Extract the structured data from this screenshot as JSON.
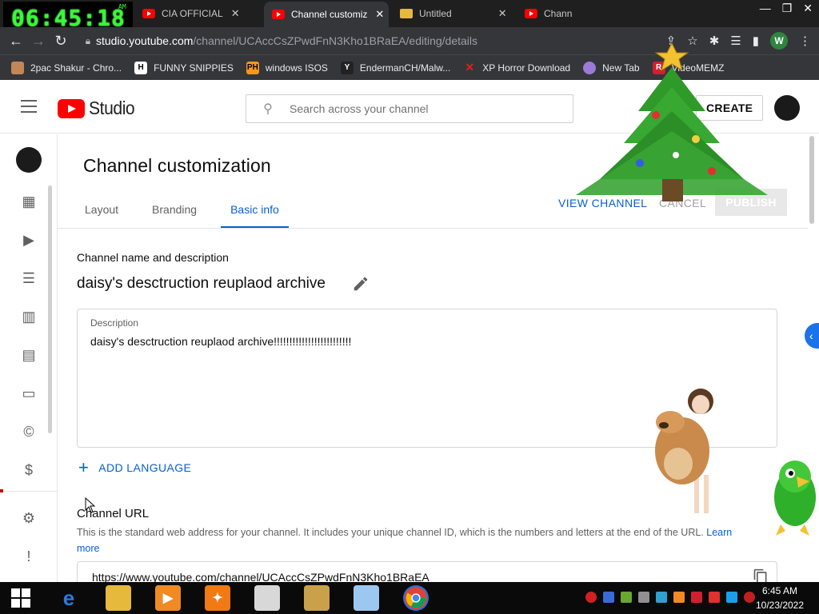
{
  "clock": {
    "time": "06:45:18",
    "ampm": "AM"
  },
  "browser": {
    "tabs": [
      {
        "title": "",
        "icon": "ph-icon"
      },
      {
        "title": "CIA OFFICIAL",
        "icon": "youtube-icon"
      },
      {
        "title": "Channel customiz",
        "icon": "youtube-icon",
        "active": true
      },
      {
        "title": "Untitled",
        "icon": "folder-icon"
      },
      {
        "title": "Chann",
        "icon": "youtube-icon"
      }
    ],
    "url_host": "studio.youtube.com",
    "url_path": "/channel/UCAccCsZPwdFnN3Kho1BRaEA/editing/details",
    "profile_initial": "W",
    "bookmarks": [
      {
        "label": "2pac Shakur - Chro...",
        "icon": "pac-icon",
        "color": "#d0a060"
      },
      {
        "label": "FUNNY SNIPPIES",
        "icon": "h-icon",
        "color": "#ffffff"
      },
      {
        "label": "windows ISOS",
        "icon": "ph-icon",
        "color": "#f7971d"
      },
      {
        "label": "EndermanCH/Malw...",
        "icon": "yp-icon",
        "color": "#222222"
      },
      {
        "label": "XP Horror Download",
        "icon": "x-icon",
        "color": "#e02020"
      },
      {
        "label": "New Tab",
        "icon": "globe-icon",
        "color": "#9b7ad8"
      },
      {
        "label": "VideoMEMZ",
        "icon": "r-icon",
        "color": "#d02030"
      }
    ]
  },
  "studio": {
    "wordmark": "Studio",
    "search_placeholder": "Search across your channel",
    "create_label": "CREATE",
    "page_title": "Channel customization",
    "tabs": [
      {
        "label": "Layout"
      },
      {
        "label": "Branding"
      },
      {
        "label": "Basic info",
        "active": true
      }
    ],
    "view_channel_label": "VIEW CHANNEL",
    "cancel_label": "CANCEL",
    "publish_label": "PUBLISH",
    "section_heading": "Channel name and description",
    "channel_name": "daisy's desctruction reuplaod archive",
    "description_label": "Description",
    "description_text": "daisy's desctruction reuplaod archive!!!!!!!!!!!!!!!!!!!!!!!!!",
    "add_language_label": "ADD LANGUAGE",
    "url_heading": "Channel URL",
    "url_help": "This is the standard web address for your channel. It includes your unique channel ID, which is the numbers and letters at the end of the URL.",
    "learn_more": "Learn more",
    "channel_url": "https://www.youtube.com/channel/UCAccCsZPwdFnN3Kho1BRaEA"
  },
  "taskbar": {
    "time": "6:45 AM",
    "date": "10/23/2022"
  },
  "colors": {
    "accent_blue": "#065fd4",
    "youtube_red": "#ff0000",
    "chrome_dark": "#35363a"
  }
}
